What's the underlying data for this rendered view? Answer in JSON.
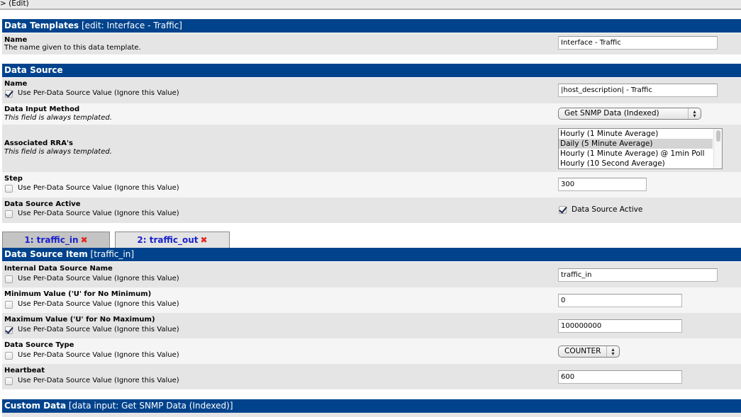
{
  "breadcrumb": "> (Edit)",
  "sections": {
    "data_templates": {
      "title": "Data Templates",
      "subtitle": "[edit: Interface - Traffic]",
      "name_title": "Name",
      "name_desc": "The name given to this data template.",
      "name_value": "Interface - Traffic"
    },
    "data_source": {
      "title": "Data Source",
      "name": {
        "title": "Name",
        "checkbox_label": "Use Per-Data Source Value (Ignore this Value)",
        "checked": true,
        "value": "|host_description| - Traffic"
      },
      "input_method": {
        "title": "Data Input Method",
        "desc": "This field is always templated.",
        "selected": "Get SNMP Data (Indexed)"
      },
      "rras": {
        "title": "Associated RRA's",
        "desc": "This field is always templated.",
        "options": [
          {
            "label": "Hourly (1 Minute Average)",
            "selected": false
          },
          {
            "label": "Daily (5 Minute Average)",
            "selected": true
          },
          {
            "label": "Hourly (1 Minute Average) @ 1min Poll",
            "selected": false
          },
          {
            "label": "Hourly (10 Second Average)",
            "selected": false
          }
        ]
      },
      "step": {
        "title": "Step",
        "checkbox_label": "Use Per-Data Source Value (Ignore this Value)",
        "checked": false,
        "value": "300"
      },
      "active": {
        "title": "Data Source Active",
        "checkbox_label": "Use Per-Data Source Value (Ignore this Value)",
        "checked": false,
        "value_label": "Data Source Active",
        "value_checked": true
      }
    },
    "tabs": [
      {
        "label": "1: traffic_in",
        "active": true
      },
      {
        "label": "2: traffic_out",
        "active": false
      }
    ],
    "data_source_item": {
      "title": "Data Source Item",
      "subtitle": "[traffic_in]",
      "internal_name": {
        "title": "Internal Data Source Name",
        "checkbox_label": "Use Per-Data Source Value (Ignore this Value)",
        "checked": false,
        "value": "traffic_in"
      },
      "min_value": {
        "title": "Minimum Value ('U' for No Minimum)",
        "checkbox_label": "Use Per-Data Source Value (Ignore this Value)",
        "checked": false,
        "value": "0"
      },
      "max_value": {
        "title": "Maximum Value ('U' for No Maximum)",
        "checkbox_label": "Use Per-Data Source Value (Ignore this Value)",
        "checked": true,
        "value": "100000000"
      },
      "ds_type": {
        "title": "Data Source Type",
        "checkbox_label": "Use Per-Data Source Value (Ignore this Value)",
        "checked": false,
        "selected": "COUNTER"
      },
      "heartbeat": {
        "title": "Heartbeat",
        "checkbox_label": "Use Per-Data Source Value (Ignore this Value)",
        "checked": false,
        "value": "600"
      }
    },
    "custom_data": {
      "title": "Custom Data",
      "subtitle": "[data input: Get SNMP Data (Indexed)]"
    }
  },
  "colors": {
    "header_bg": "#00438c",
    "row_dark": "#e5e5e5",
    "row_light": "#f5f5f5",
    "tab_link": "#1a22cc",
    "delete_x": "#e3261e"
  },
  "icons": {
    "delete": "✖",
    "select_arrows": "▲▼"
  }
}
